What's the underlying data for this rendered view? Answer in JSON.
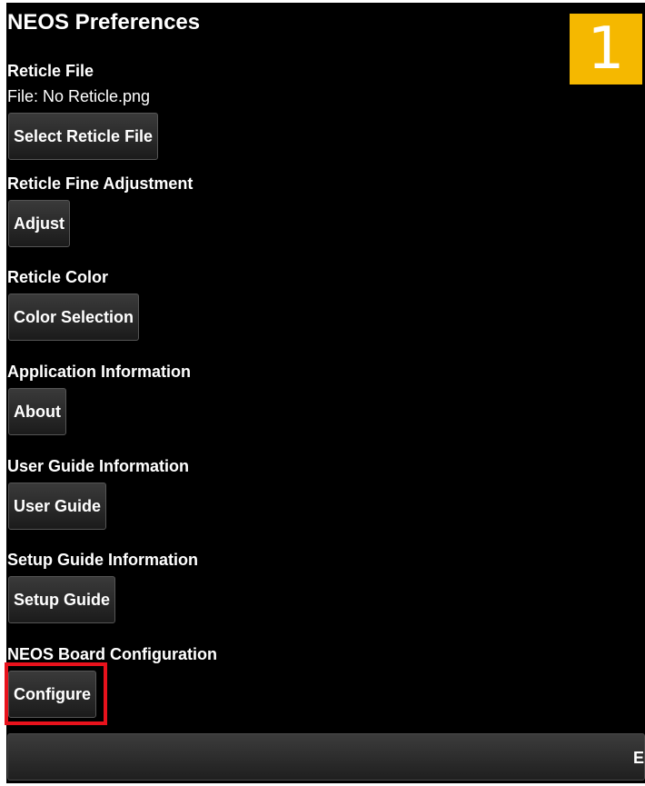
{
  "colors": {
    "background": "#000000",
    "badge": "#f5b800",
    "highlight": "#e8121c"
  },
  "page": {
    "title": "NEOS Preferences",
    "step_number": "1"
  },
  "sections": [
    {
      "label": "Reticle File",
      "value": "File: No Reticle.png",
      "button": "Select Reticle File"
    },
    {
      "label": "Reticle Fine Adjustment",
      "button": "Adjust"
    },
    {
      "label": "Reticle Color",
      "button": "Color Selection"
    },
    {
      "label": "Application Information",
      "button": "About"
    },
    {
      "label": "User Guide Information",
      "button": "User Guide"
    },
    {
      "label": "Setup Guide Information",
      "button": "Setup Guide"
    },
    {
      "label": "NEOS Board Configuration",
      "button": "Configure"
    }
  ],
  "bottom_bar": {
    "partial_text": "E"
  }
}
